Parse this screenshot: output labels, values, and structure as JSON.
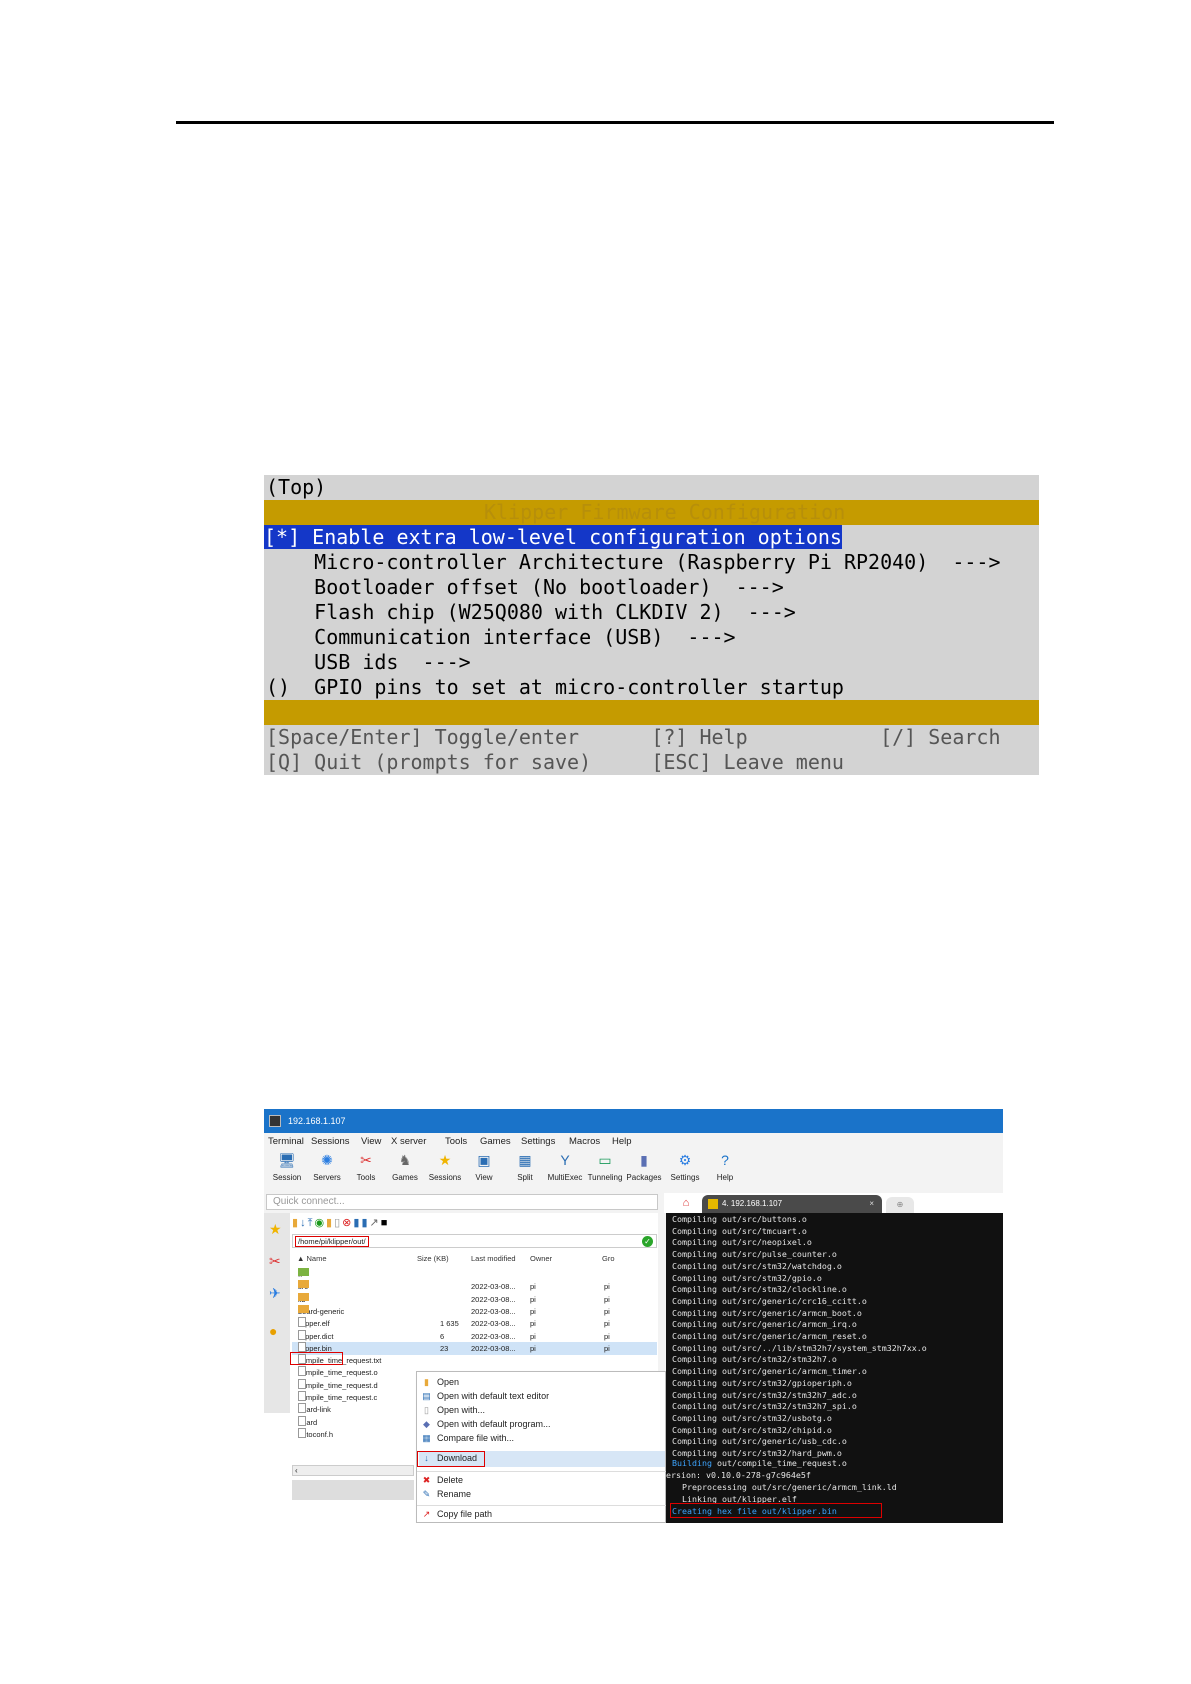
{
  "menuconfig": {
    "top": "(Top)",
    "title": "Klipper Firmware Configuration",
    "selected": "[*] Enable extra low-level configuration options",
    "items": [
      "    Micro-controller Architecture (Raspberry Pi RP2040)  --->",
      "    Bootloader offset (No bootloader)  --->",
      "    Flash chip (W25Q080 with CLKDIV 2)  --->",
      "    Communication interface (USB)  --->",
      "    USB ids  --->",
      "()  GPIO pins to set at micro-controller startup"
    ],
    "footer": [
      "[Space/Enter] Toggle/enter      [?] Help           [/] Search",
      "[Q] Quit (prompts for save)     [ESC] Leave menu"
    ]
  },
  "moba": {
    "window_title": "192.168.1.107",
    "menu": [
      "Terminal",
      "Sessions",
      "View",
      "X server",
      "Tools",
      "Games",
      "Settings",
      "Macros",
      "Help"
    ],
    "toolbar": [
      {
        "label": "Session",
        "icon": "session-icon",
        "glyph": "🖥",
        "color": "#2a6db3"
      },
      {
        "label": "Servers",
        "icon": "servers-icon",
        "glyph": "✺",
        "color": "#2a7de1"
      },
      {
        "label": "Tools",
        "icon": "tools-icon",
        "glyph": "✂",
        "color": "#d33"
      },
      {
        "label": "Games",
        "icon": "games-icon",
        "glyph": "♞",
        "color": "#666"
      },
      {
        "label": "Sessions",
        "icon": "sessions-star-icon",
        "glyph": "★",
        "color": "#f0b400"
      },
      {
        "label": "View",
        "icon": "view-icon",
        "glyph": "▣",
        "color": "#2a6db3"
      },
      {
        "label": "Split",
        "icon": "split-icon",
        "glyph": "▦",
        "color": "#2a6db3"
      },
      {
        "label": "MultiExec",
        "icon": "multiexec-icon",
        "glyph": "Y",
        "color": "#2a6db3"
      },
      {
        "label": "Tunneling",
        "icon": "tunneling-icon",
        "glyph": "▭",
        "color": "#1a9a5a"
      },
      {
        "label": "Packages",
        "icon": "packages-icon",
        "glyph": "▮",
        "color": "#5a6fb3"
      },
      {
        "label": "Settings",
        "icon": "settings-icon",
        "glyph": "⚙",
        "color": "#2a7de1"
      },
      {
        "label": "Help",
        "icon": "help-icon",
        "glyph": "?",
        "color": "#1a73c9"
      }
    ],
    "quick_connect": "Quick connect...",
    "path": "/home/pi/klipper/out/",
    "headers": {
      "name": "Name",
      "size": "Size (KB)",
      "modified": "Last modified",
      "owner": "Owner",
      "group": "Gro"
    },
    "files": [
      {
        "name": "..",
        "size": "",
        "modified": "",
        "owner": "",
        "group": "",
        "type": "up"
      },
      {
        "name": "src",
        "size": "",
        "modified": "2022-03-08...",
        "owner": "pi",
        "group": "pi",
        "type": "folder"
      },
      {
        "name": "lib",
        "size": "",
        "modified": "2022-03-08...",
        "owner": "pi",
        "group": "pi",
        "type": "folder"
      },
      {
        "name": "board-generic",
        "size": "",
        "modified": "2022-03-08...",
        "owner": "pi",
        "group": "pi",
        "type": "folder"
      },
      {
        "name": "klipper.elf",
        "size": "1 635",
        "modified": "2022-03-08...",
        "owner": "pi",
        "group": "pi",
        "type": "file"
      },
      {
        "name": "klipper.dict",
        "size": "6",
        "modified": "2022-03-08...",
        "owner": "pi",
        "group": "pi",
        "type": "file"
      },
      {
        "name": "klipper.bin",
        "size": "23",
        "modified": "2022-03-08...",
        "owner": "pi",
        "group": "pi",
        "type": "file"
      },
      {
        "name": "compile_time_request.txt",
        "size": "",
        "modified": "",
        "owner": "",
        "group": "",
        "type": "file"
      },
      {
        "name": "compile_time_request.o",
        "size": "",
        "modified": "",
        "owner": "",
        "group": "",
        "type": "file"
      },
      {
        "name": "compile_time_request.d",
        "size": "",
        "modified": "",
        "owner": "",
        "group": "",
        "type": "file"
      },
      {
        "name": "compile_time_request.c",
        "size": "",
        "modified": "",
        "owner": "",
        "group": "",
        "type": "file"
      },
      {
        "name": "board-link",
        "size": "",
        "modified": "",
        "owner": "",
        "group": "",
        "type": "file"
      },
      {
        "name": "board",
        "size": "",
        "modified": "",
        "owner": "",
        "group": "",
        "type": "file"
      },
      {
        "name": "autoconf.h",
        "size": "",
        "modified": "",
        "owner": "",
        "group": "",
        "type": "file"
      }
    ],
    "context_menu": {
      "open": "Open",
      "open_default_editor": "Open with default text editor",
      "open_with": "Open with...",
      "open_default_program": "Open with default program...",
      "compare": "Compare file with...",
      "download": "Download",
      "delete": "Delete",
      "rename": "Rename",
      "copy_path": "Copy file path"
    },
    "terminal_tab": "4. 192.168.1.107",
    "terminal_lines": [
      "Compiling out/src/buttons.o",
      "Compiling out/src/tmcuart.o",
      "Compiling out/src/neopixel.o",
      "Compiling out/src/pulse_counter.o",
      "Compiling out/src/stm32/watchdog.o",
      "Compiling out/src/stm32/gpio.o",
      "Compiling out/src/stm32/clockline.o",
      "Compiling out/src/generic/crc16_ccitt.o",
      "Compiling out/src/generic/armcm_boot.o",
      "Compiling out/src/generic/armcm_irq.o",
      "Compiling out/src/generic/armcm_reset.o",
      "Compiling out/src/../lib/stm32h7/system_stm32h7xx.o",
      "Compiling out/src/stm32/stm32h7.o",
      "Compiling out/src/generic/armcm_timer.o",
      "Compiling out/src/stm32/gpioperiph.o",
      "Compiling out/src/stm32/stm32h7_adc.o",
      "Compiling out/src/stm32/stm32h7_spi.o",
      "Compiling out/src/stm32/usbotg.o",
      "Compiling out/src/stm32/chipid.o",
      "Compiling out/src/generic/usb_cdc.o",
      "Compiling out/src/stm32/hard_pwm.o"
    ],
    "building_word": "Building",
    "building_rest": " out/compile_time_request.o",
    "version_line": "ersion: v0.10.0-278-g7c964e5f",
    "preprocessing_line": "  Preprocessing out/src/generic/armcm_link.ld",
    "linking_line": "  Linking out/klipper.elf",
    "creating_line": "Creating hex file out/klipper.bin"
  }
}
